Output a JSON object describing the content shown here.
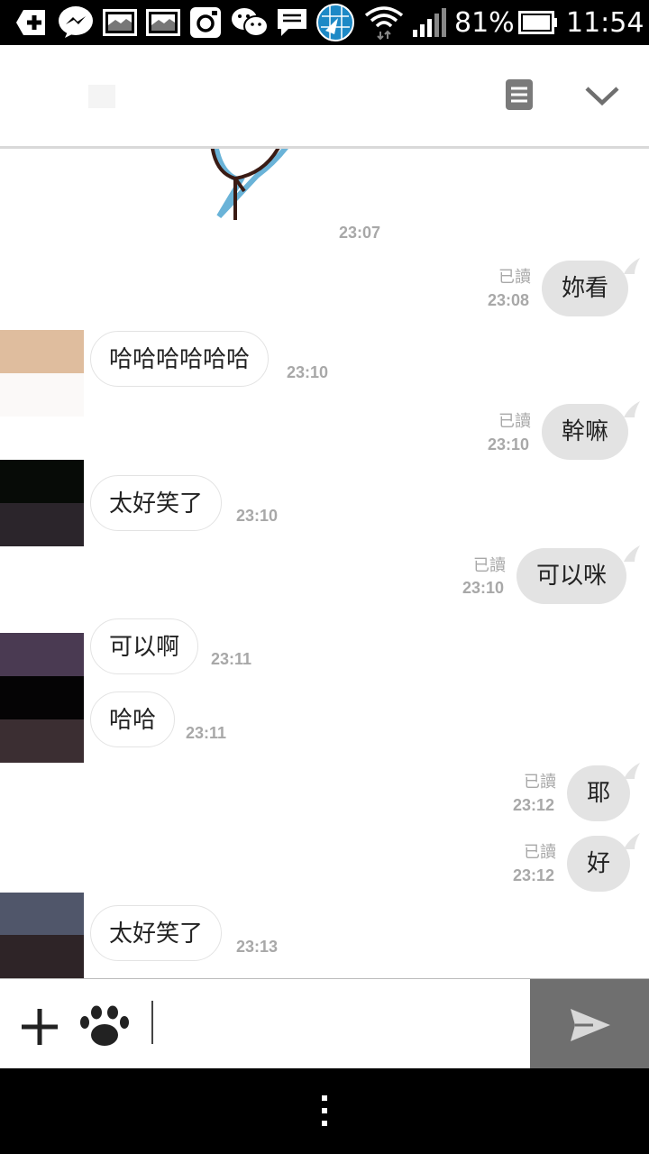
{
  "status_bar": {
    "battery_percent": "81%",
    "time": "11:54",
    "icons": [
      "add-icon",
      "messenger-icon",
      "image-icon",
      "image-icon",
      "instagram-icon",
      "wechat-icon",
      "message-icon",
      "browser-icon",
      "wifi-icon",
      "signal-icon",
      "battery-icon"
    ]
  },
  "header": {
    "menu_icon": "list-icon",
    "collapse_icon": "chevron-down-icon"
  },
  "chat": {
    "sticker_time": "23:07",
    "messages": [
      {
        "dir": "out",
        "text": "妳看",
        "read": "已讀",
        "time": "23:08"
      },
      {
        "dir": "in",
        "text": "哈哈哈哈哈哈",
        "time": "23:10"
      },
      {
        "dir": "out",
        "text": "幹嘛",
        "read": "已讀",
        "time": "23:10"
      },
      {
        "dir": "in",
        "text": "太好笑了",
        "time": "23:10"
      },
      {
        "dir": "out",
        "text": "可以咪",
        "read": "已讀",
        "time": "23:10"
      },
      {
        "dir": "in",
        "text": "可以啊",
        "time": "23:11"
      },
      {
        "dir": "in",
        "text": "哈哈",
        "time": "23:11"
      },
      {
        "dir": "out",
        "text": "耶",
        "read": "已讀",
        "time": "23:12"
      },
      {
        "dir": "out",
        "text": "好",
        "read": "已讀",
        "time": "23:12"
      },
      {
        "dir": "in",
        "text": "太好笑了",
        "time": "23:13"
      }
    ]
  },
  "input_bar": {
    "add_icon": "plus-icon",
    "sticker_icon": "paw-icon",
    "send_icon": "send-icon",
    "message_value": ""
  },
  "nav_bar": {
    "menu_icon": "overflow-menu-icon"
  }
}
